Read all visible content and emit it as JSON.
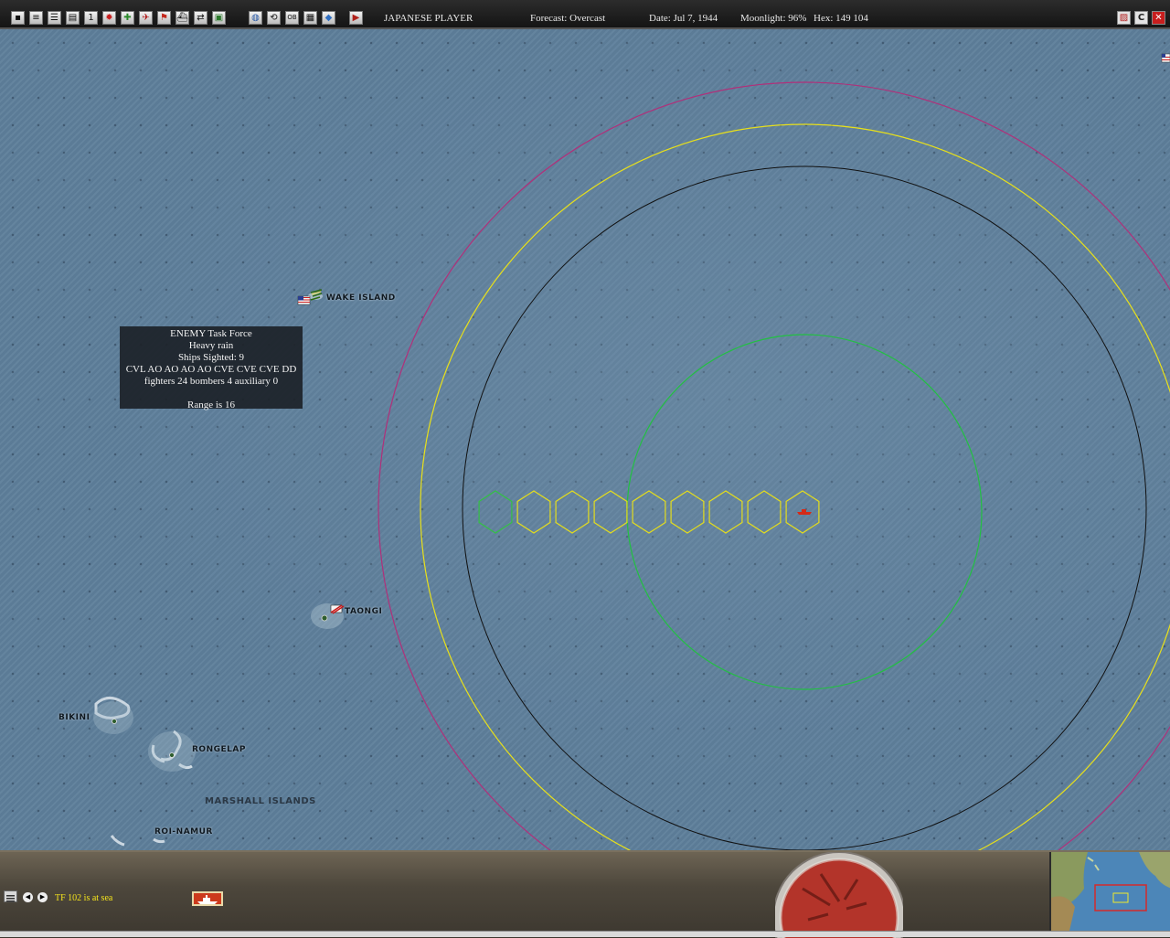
{
  "toolbar": {
    "left_buttons": [
      {
        "name": "select-icon",
        "glyph": "▪"
      },
      {
        "name": "document-icon",
        "glyph": "≡"
      },
      {
        "name": "list-icon",
        "glyph": "☰"
      },
      {
        "name": "report-icon",
        "glyph": "▤"
      },
      {
        "name": "number-one-icon",
        "glyph": "1"
      },
      {
        "name": "rising-sun-flag-icon",
        "glyph": "✹"
      },
      {
        "name": "green-cross-icon",
        "glyph": "✚"
      },
      {
        "name": "red-plane-icon",
        "glyph": "✈"
      },
      {
        "name": "red-flag-icon",
        "glyph": "⚑"
      },
      {
        "name": "ship-icon",
        "glyph": "⛴"
      },
      {
        "name": "shuffle-icon",
        "glyph": "⇄"
      },
      {
        "name": "map-marker-icon",
        "glyph": "▣"
      },
      {
        "name": "globe-icon",
        "glyph": "◍"
      },
      {
        "name": "refresh-icon",
        "glyph": "⟲"
      },
      {
        "name": "ob-icon",
        "glyph": "OB"
      },
      {
        "name": "table-icon",
        "glyph": "▦"
      },
      {
        "name": "bubble-icon",
        "glyph": "◆"
      },
      {
        "name": "play-icon",
        "glyph": "▶"
      }
    ],
    "player": "JAPANESE PLAYER",
    "forecast": "Forecast: Overcast",
    "date": "Date: Jul 7, 1944",
    "moonlight": "Moonlight: 96%",
    "hex": "Hex: 149 104",
    "right_buttons": [
      {
        "name": "flag-toggle-icon",
        "glyph": "▨"
      },
      {
        "name": "c-icon",
        "glyph": "C"
      },
      {
        "name": "close-icon",
        "glyph": "✕"
      }
    ]
  },
  "map": {
    "labels": {
      "wake": "WAKE ISLAND",
      "taongi": "TAONGI",
      "bikini": "BIKINI",
      "rongelap": "RONGELAP",
      "marshall": "MARSHALL ISLANDS",
      "roi_namur": "ROI-NAMUR"
    },
    "range_rings": [
      {
        "name": "outer-range-ring",
        "color": "#b0307a"
      },
      {
        "name": "yellow-range-ring",
        "color": "#e8e01a"
      },
      {
        "name": "black-range-ring",
        "color": "#111111"
      },
      {
        "name": "green-range-ring",
        "color": "#22c042"
      }
    ],
    "hex_path": {
      "green_count": 1,
      "yellow_count": 8,
      "green_color": "#33c144",
      "yellow_color": "#e4dd1c"
    }
  },
  "tf_popup": {
    "line1": "ENEMY Task Force",
    "line2": "Heavy rain",
    "line3": "Ships Sighted: 9",
    "line4": "CVL AO AO AO AO CVE CVE CVE DD",
    "line5": "fighters 24  bombers 4  auxiliary 0",
    "line6": "",
    "line7": "Range is 16"
  },
  "bottom": {
    "status": "TF 102 is at sea"
  }
}
